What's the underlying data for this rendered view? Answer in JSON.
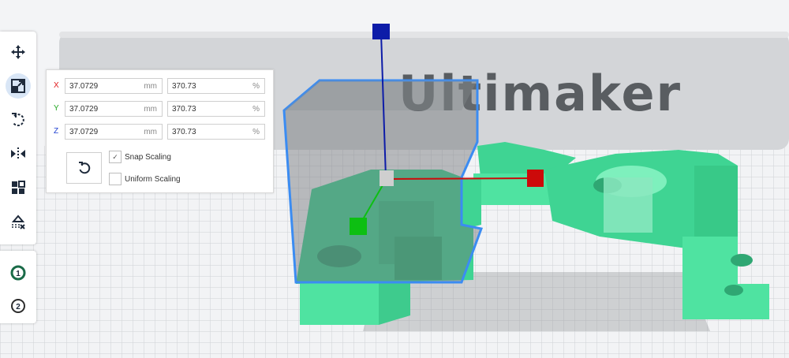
{
  "viewport": {
    "logo_text": "Ultimaker"
  },
  "toolbar": {
    "tools": [
      {
        "name": "move-tool",
        "icon": "move-icon"
      },
      {
        "name": "scale-tool",
        "icon": "scale-icon",
        "active": true
      },
      {
        "name": "rotate-tool",
        "icon": "rotate-icon"
      },
      {
        "name": "mirror-tool",
        "icon": "mirror-icon"
      },
      {
        "name": "per-model-settings-tool",
        "icon": "per-model-settings-icon"
      },
      {
        "name": "support-blocker-tool",
        "icon": "support-blocker-icon"
      }
    ],
    "extruders": [
      "1",
      "2"
    ]
  },
  "scale_panel": {
    "x": {
      "axis": "X",
      "mm": "37.0729",
      "mm_unit": "mm",
      "percent": "370.73",
      "percent_unit": "%",
      "color": "#e0191b"
    },
    "y": {
      "axis": "Y",
      "mm": "37.0729",
      "mm_unit": "mm",
      "percent": "370.73",
      "percent_unit": "%",
      "color": "#22a822"
    },
    "z": {
      "axis": "Z",
      "mm": "37.0729",
      "mm_unit": "mm",
      "percent": "370.73",
      "percent_unit": "%",
      "color": "#1f3fd0"
    },
    "snap_scaling": {
      "label": "Snap Scaling",
      "checked": true,
      "mark": "✓"
    },
    "uniform_scaling": {
      "label": "Uniform Scaling",
      "checked": false
    }
  },
  "colors": {
    "model": "#4fe3a1",
    "selection_outline": "#3b8cf2",
    "handle_x": "#cc0a0a",
    "handle_y": "#0dbf12",
    "handle_z": "#0d1ca8"
  }
}
